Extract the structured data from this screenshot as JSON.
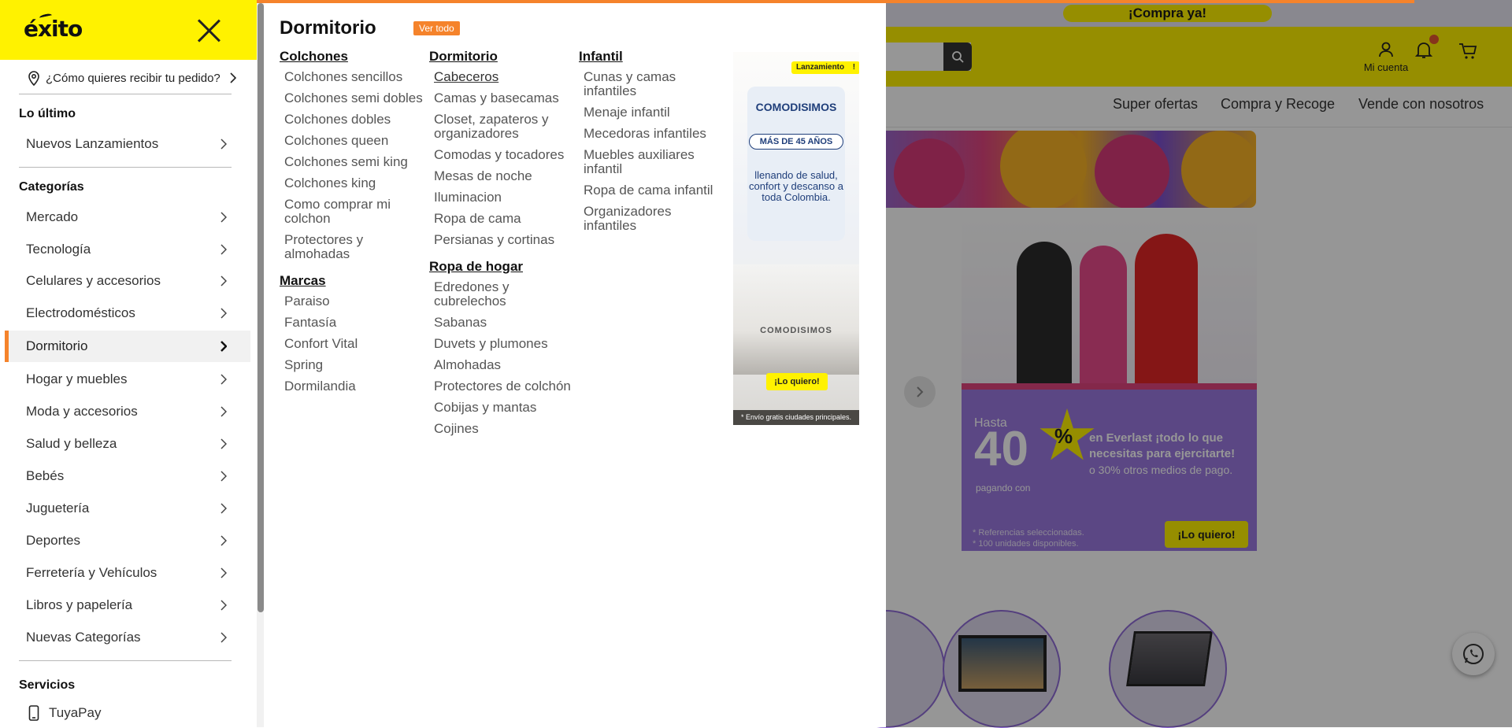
{
  "site": {
    "promo_pill": "¡Compra ya!",
    "account_label": "Mi cuenta",
    "nav_links": [
      "Super ofertas",
      "Compra y Recoge",
      "Vende con nosotros"
    ],
    "banner": {
      "hasta": "Hasta",
      "percent": "40",
      "percent_symbol": "%",
      "paying_with": "pagando con",
      "headline": "en Everlast ¡todo lo que necesitas para ejercitarte!",
      "subline": "o 30% otros medios de pago.",
      "fine_print_1": "* Referencias seleccionadas.",
      "fine_print_2": "* 100 unidades disponibles.",
      "cta": "¡Lo quiero!"
    },
    "accent_color": "#fff200",
    "brand_orange": "#f5832b"
  },
  "menu": {
    "logo_text": "éxito",
    "delivery_prompt": "¿Cómo quieres recibir tu pedido?",
    "latest_title": "Lo último",
    "latest_items": [
      {
        "label": "Nuevos Lanzamientos"
      }
    ],
    "categories_title": "Categorías",
    "categories": [
      {
        "label": "Mercado"
      },
      {
        "label": "Tecnología"
      },
      {
        "label": "Celulares y accesorios"
      },
      {
        "label": "Electrodomésticos"
      },
      {
        "label": "Dormitorio",
        "active": true
      },
      {
        "label": "Hogar y muebles"
      },
      {
        "label": "Moda y accesorios"
      },
      {
        "label": "Salud y belleza"
      },
      {
        "label": "Bebés"
      },
      {
        "label": "Juguetería"
      },
      {
        "label": "Deportes"
      },
      {
        "label": "Ferretería y Vehículos"
      },
      {
        "label": "Libros y papelería"
      },
      {
        "label": "Nuevas Categorías"
      }
    ],
    "services_title": "Servicios",
    "services": [
      {
        "label": "TuyaPay",
        "icon": "phone-icon"
      }
    ]
  },
  "submenu": {
    "title": "Dormitorio",
    "see_all": "Ver todo",
    "col1": [
      {
        "heading": "Colchones",
        "links": [
          "Colchones sencillos",
          "Colchones semi dobles",
          "Colchones dobles",
          "Colchones queen",
          "Colchones semi king",
          "Colchones king",
          "Como comprar mi colchon",
          "Protectores y almohadas"
        ]
      },
      {
        "heading": "Marcas",
        "links": [
          "Paraiso",
          "Fantasía",
          "Confort Vital",
          "Spring",
          "Dormilandia"
        ]
      }
    ],
    "col2": [
      {
        "heading": "Dormitorio",
        "links": [
          "Cabeceros",
          "Camas y basecamas",
          "Closet, zapateros y organizadores",
          "Comodas y tocadores",
          "Mesas de noche",
          "Iluminacion",
          "Ropa de cama",
          "Persianas y cortinas"
        ]
      },
      {
        "heading": "Ropa de hogar",
        "links": [
          "Edredones y cubrelechos",
          "Sabanas",
          "Duvets y plumones",
          "Almohadas",
          "Protectores de colchón",
          "Cobijas y mantas",
          "Cojines"
        ]
      }
    ],
    "col3": [
      {
        "heading": "Infantil",
        "links": [
          "Cunas y camas infantiles",
          "Menaje infantil",
          "Mecedoras infantiles",
          "Muebles auxiliares infantil",
          "Ropa de cama infantil",
          "Organizadores infantiles"
        ]
      }
    ],
    "ad": {
      "badge": "Lanzamiento",
      "badge_mark": "!",
      "brand": "COMODISIMOS",
      "years": "MÁS DE 45 AÑOS",
      "copy": "llenando de salud, confort y descanso a toda Colombia.",
      "brand_small": "COMODISIMOS",
      "cta": "¡Lo quiero!",
      "footnote": "* Envío gratis ciudades principales."
    }
  }
}
